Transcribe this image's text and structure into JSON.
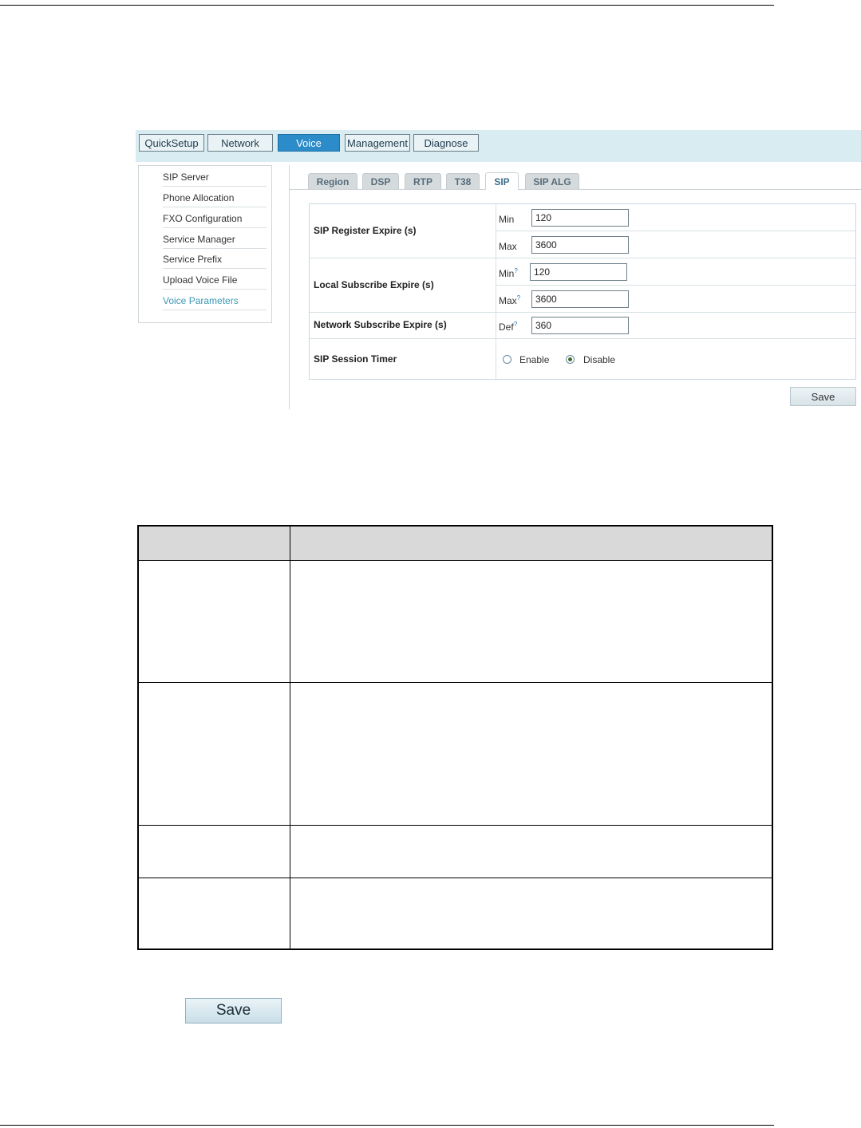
{
  "nav": {
    "tabs": [
      {
        "label": "QuickSetup"
      },
      {
        "label": "Network"
      },
      {
        "label": "Voice"
      },
      {
        "label": "Management"
      },
      {
        "label": "Diagnose"
      }
    ],
    "active": "Voice"
  },
  "sidebar": {
    "items": [
      {
        "label": "SIP Server"
      },
      {
        "label": "Phone Allocation"
      },
      {
        "label": "FXO Configuration"
      },
      {
        "label": "Service Manager"
      },
      {
        "label": "Service Prefix"
      },
      {
        "label": "Upload Voice File"
      },
      {
        "label": "Voice Parameters"
      }
    ],
    "current": "Voice Parameters"
  },
  "subtabs": {
    "items": [
      {
        "label": "Region"
      },
      {
        "label": "DSP"
      },
      {
        "label": "RTP"
      },
      {
        "label": "T38"
      },
      {
        "label": "SIP"
      },
      {
        "label": "SIP ALG"
      }
    ],
    "active": "SIP"
  },
  "form": {
    "register": {
      "label": "SIP Register Expire (s)",
      "min_label": "Min",
      "min_value": "120",
      "max_label": "Max",
      "max_value": "3600"
    },
    "local": {
      "label": "Local Subscribe Expire (s)",
      "min_label": "Min",
      "min_value": "120",
      "max_label": "Max",
      "max_value": "3600"
    },
    "network": {
      "label": "Network Subscribe Expire (s)",
      "def_label": "Def",
      "def_value": "360"
    },
    "timer": {
      "label": "SIP Session Timer",
      "enable_label": "Enable",
      "disable_label": "Disable",
      "selected": "Disable"
    },
    "help_mark": "?",
    "save_label": "Save"
  },
  "doc": {
    "save_label": "Save"
  },
  "colors": {
    "nav_active": "#2c8bc9",
    "topbar": "#d8ecf1",
    "sidebar_current": "#3a99b4",
    "table_header": "#d9d9d9"
  }
}
